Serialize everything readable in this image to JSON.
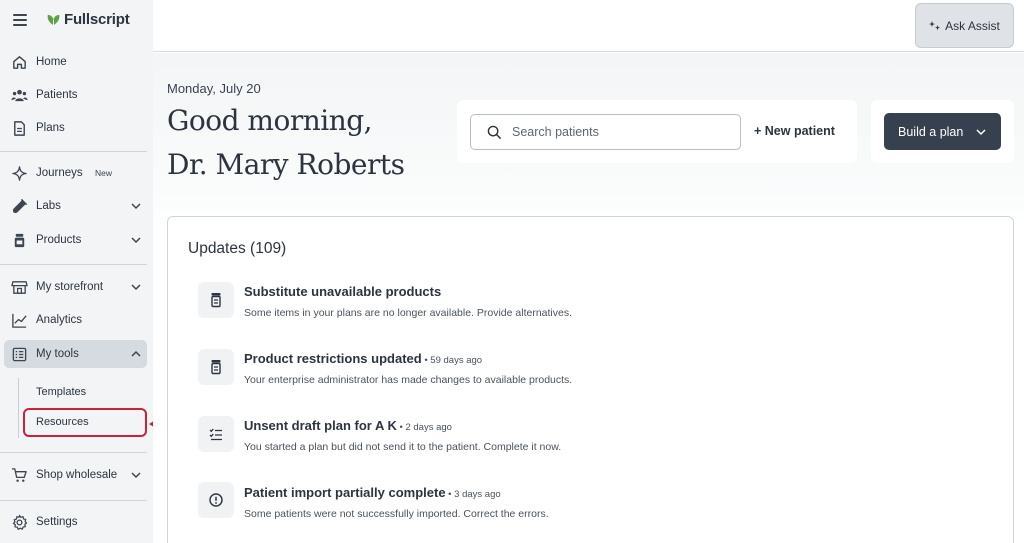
{
  "brand": {
    "name": "Fullscript"
  },
  "sidebar": {
    "items": [
      {
        "label": "Home",
        "icon": "home-icon"
      },
      {
        "label": "Patients",
        "icon": "patients-icon"
      },
      {
        "label": "Plans",
        "icon": "document-icon"
      },
      {
        "label": "Journeys",
        "icon": "sparkle-icon",
        "badge": "New"
      },
      {
        "label": "Labs",
        "icon": "test-tube-icon"
      },
      {
        "label": "Products",
        "icon": "bottle-icon"
      },
      {
        "label": "My storefront",
        "icon": "storefront-icon"
      },
      {
        "label": "Analytics",
        "icon": "chart-line-icon"
      },
      {
        "label": "My tools",
        "icon": "tools-icon"
      },
      {
        "label": "Shop wholesale",
        "icon": "cart-icon"
      },
      {
        "label": "Settings",
        "icon": "gear-icon"
      }
    ],
    "subitems": [
      {
        "label": "Templates"
      },
      {
        "label": "Resources"
      }
    ]
  },
  "topbar": {
    "ask_assist_label": "Ask Assist"
  },
  "header": {
    "date": "Monday, July 20",
    "greeting_line1": "Good morning,",
    "greeting_line2": "Dr. Mary Roberts"
  },
  "search": {
    "placeholder": "Search patients"
  },
  "actions": {
    "new_patient_label": "+ New patient",
    "build_plan_label": "Build a plan"
  },
  "updates": {
    "title": "Updates (109)",
    "items": [
      {
        "title": "Substitute unavailable products",
        "meta": "",
        "description": "Some items in your plans are no longer available. Provide alternatives.",
        "icon": "bottle-icon"
      },
      {
        "title": "Product restrictions updated",
        "meta": " • 59 days ago",
        "description": "Your enterprise administrator has made changes to available products.",
        "icon": "bottle-icon"
      },
      {
        "title": "Unsent draft plan for A K",
        "meta": " • 2 days ago",
        "description": "You started a plan but did not send it to the patient. Complete it now.",
        "icon": "checklist-icon"
      },
      {
        "title": "Patient import partially complete",
        "meta": " • 3 days ago",
        "description": "Some patients were not successfully imported. Correct the errors.",
        "icon": "alert-circle-icon"
      }
    ]
  },
  "colors": {
    "sidebar_bg": "#f2f4f6",
    "primary_button": "#36404f",
    "highlight_red": "#c8223e",
    "brand_green": "#5aa53f"
  }
}
